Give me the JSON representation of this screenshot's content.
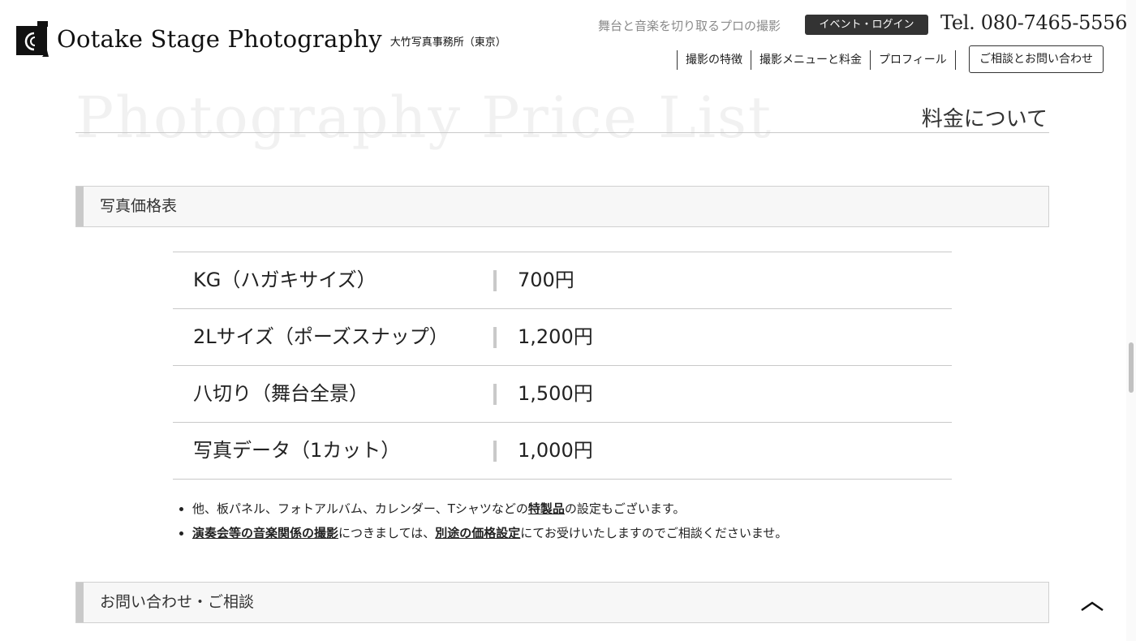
{
  "header": {
    "brand": "Ootake Stage Photography",
    "brand_sub": "大竹写真事務所（東京）",
    "tagline": "舞台と音楽を切り取るプロの撮影",
    "login_label": "イベント・ログイン",
    "tel": "Tel. 080-7465-5556",
    "nav": [
      "撮影の特徴",
      "撮影メニューと料金",
      "プロフィール"
    ],
    "contact_label": "ご相談とお問い合わせ"
  },
  "page": {
    "bg_title": "Photography Price List",
    "title": "料金について"
  },
  "sections": {
    "price_heading": "写真価格表",
    "contact_heading": "お問い合わせ・ご相談"
  },
  "price_table": [
    {
      "name": "KG（ハガキサイズ）",
      "price": "700円"
    },
    {
      "name": "2Lサイズ（ポーズスナップ）",
      "price": "1,200円"
    },
    {
      "name": "八切り（舞台全景）",
      "price": "1,500円"
    },
    {
      "name": "写真データ（1カット）",
      "price": "1,000円"
    }
  ],
  "notes": {
    "note1_pre": "他、板パネル、フォトアルバム、カレンダー、Tシャツなどの",
    "note1_link": "特製品",
    "note1_post": "の設定もございます。",
    "note2_link1": "演奏会等の音楽関係の撮影",
    "note2_mid": "につきましては、",
    "note2_link2": "別途の価格設定",
    "note2_post": "にてお受けいたしますのでご相談くださいませ。"
  },
  "icons": {
    "logo": "camera-logo-icon",
    "to_top": "chevron-up-icon"
  }
}
